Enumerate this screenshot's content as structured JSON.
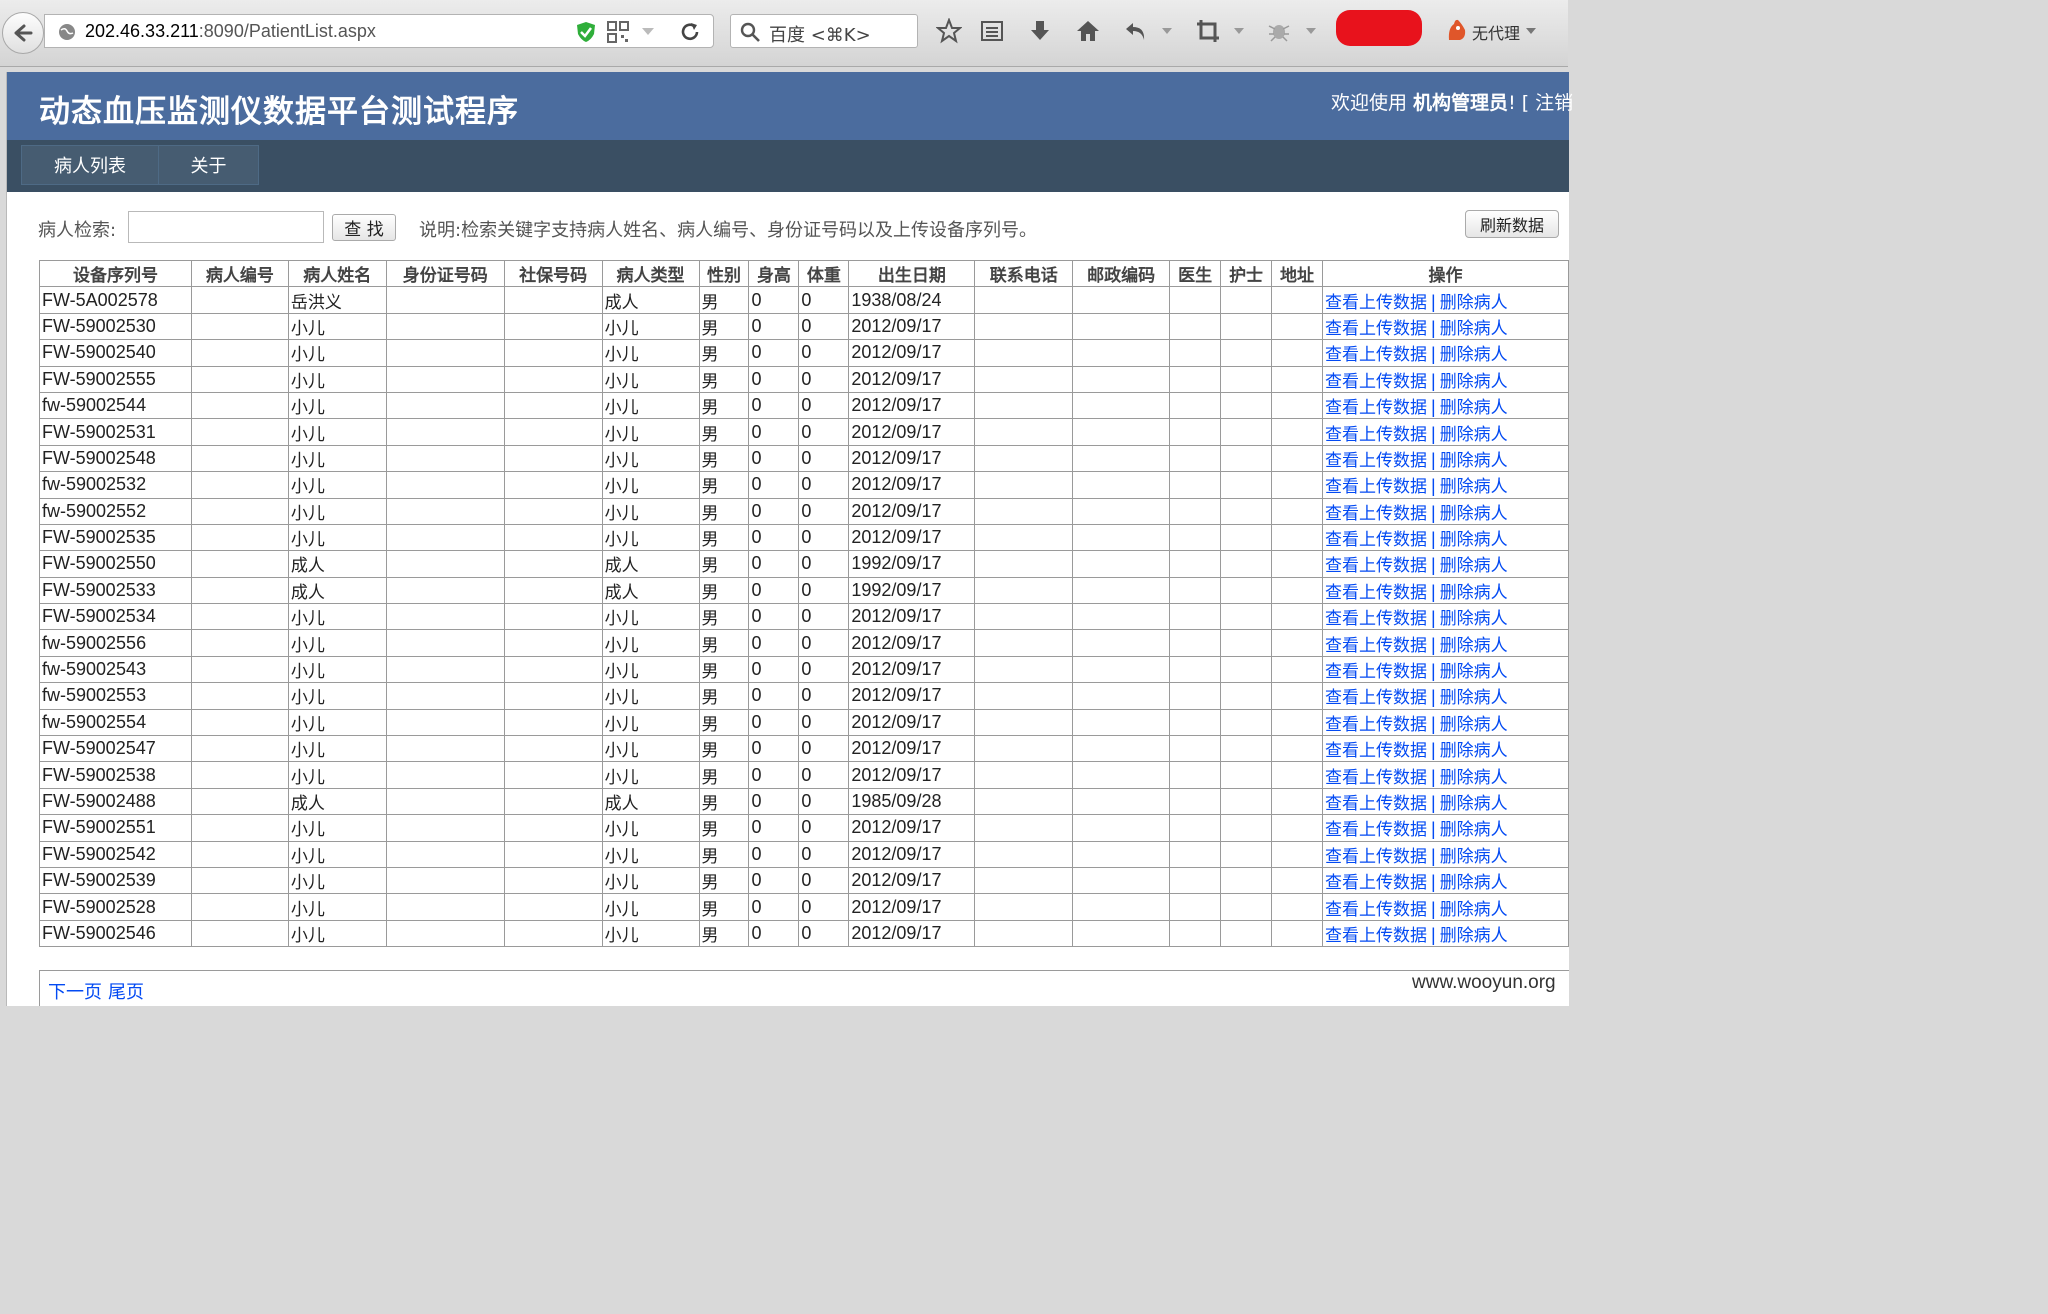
{
  "browser": {
    "url_host": "202.46.33.211",
    "url_rest": ":8090/PatientList.aspx",
    "search_placeholder": "百度 <⌘K>",
    "proxy_label": "无代理"
  },
  "header": {
    "site_title": "动态血压监测仪数据平台测试程序",
    "welcome_prefix": "欢迎使用 ",
    "user_name": "机构管理员",
    "welcome_suffix": "! [ 注销"
  },
  "nav": {
    "items": [
      "病人列表",
      "关于"
    ]
  },
  "search": {
    "label": "病人检索:",
    "value": "",
    "button": "查 找",
    "note": "说明:检索关键字支持病人姓名、病人编号、身份证号码以及上传设备序列号。",
    "refresh_button": "刷新数据"
  },
  "table": {
    "columns": [
      "设备序列号",
      "病人编号",
      "病人姓名",
      "身份证号码",
      "社保号码",
      "病人类型",
      "性别",
      "身高",
      "体重",
      "出生日期",
      "联系电话",
      "邮政编码",
      "医生",
      "护士",
      "地址",
      "操作"
    ],
    "action_view": "查看上传数据",
    "action_sep": "|",
    "action_delete": "删除病人",
    "rows": [
      {
        "serial": "FW-5A002578",
        "pid": "",
        "name": "岳洪义",
        "idcard": "",
        "insurance": "",
        "type": "成人",
        "sex": "男",
        "height": "0",
        "weight": "0",
        "dob": "1938/08/24",
        "phone": "",
        "zip": "",
        "doctor": "",
        "nurse": "",
        "address": ""
      },
      {
        "serial": "FW-59002530",
        "pid": "",
        "name": "小儿",
        "idcard": "",
        "insurance": "",
        "type": "小儿",
        "sex": "男",
        "height": "0",
        "weight": "0",
        "dob": "2012/09/17",
        "phone": "",
        "zip": "",
        "doctor": "",
        "nurse": "",
        "address": ""
      },
      {
        "serial": "FW-59002540",
        "pid": "",
        "name": "小儿",
        "idcard": "",
        "insurance": "",
        "type": "小儿",
        "sex": "男",
        "height": "0",
        "weight": "0",
        "dob": "2012/09/17",
        "phone": "",
        "zip": "",
        "doctor": "",
        "nurse": "",
        "address": ""
      },
      {
        "serial": "FW-59002555",
        "pid": "",
        "name": "小儿",
        "idcard": "",
        "insurance": "",
        "type": "小儿",
        "sex": "男",
        "height": "0",
        "weight": "0",
        "dob": "2012/09/17",
        "phone": "",
        "zip": "",
        "doctor": "",
        "nurse": "",
        "address": ""
      },
      {
        "serial": "fw-59002544",
        "pid": "",
        "name": "小儿",
        "idcard": "",
        "insurance": "",
        "type": "小儿",
        "sex": "男",
        "height": "0",
        "weight": "0",
        "dob": "2012/09/17",
        "phone": "",
        "zip": "",
        "doctor": "",
        "nurse": "",
        "address": ""
      },
      {
        "serial": "FW-59002531",
        "pid": "",
        "name": "小儿",
        "idcard": "",
        "insurance": "",
        "type": "小儿",
        "sex": "男",
        "height": "0",
        "weight": "0",
        "dob": "2012/09/17",
        "phone": "",
        "zip": "",
        "doctor": "",
        "nurse": "",
        "address": ""
      },
      {
        "serial": "FW-59002548",
        "pid": "",
        "name": "小儿",
        "idcard": "",
        "insurance": "",
        "type": "小儿",
        "sex": "男",
        "height": "0",
        "weight": "0",
        "dob": "2012/09/17",
        "phone": "",
        "zip": "",
        "doctor": "",
        "nurse": "",
        "address": ""
      },
      {
        "serial": "fw-59002532",
        "pid": "",
        "name": "小儿",
        "idcard": "",
        "insurance": "",
        "type": "小儿",
        "sex": "男",
        "height": "0",
        "weight": "0",
        "dob": "2012/09/17",
        "phone": "",
        "zip": "",
        "doctor": "",
        "nurse": "",
        "address": ""
      },
      {
        "serial": "fw-59002552",
        "pid": "",
        "name": "小儿",
        "idcard": "",
        "insurance": "",
        "type": "小儿",
        "sex": "男",
        "height": "0",
        "weight": "0",
        "dob": "2012/09/17",
        "phone": "",
        "zip": "",
        "doctor": "",
        "nurse": "",
        "address": ""
      },
      {
        "serial": "FW-59002535",
        "pid": "",
        "name": "小儿",
        "idcard": "",
        "insurance": "",
        "type": "小儿",
        "sex": "男",
        "height": "0",
        "weight": "0",
        "dob": "2012/09/17",
        "phone": "",
        "zip": "",
        "doctor": "",
        "nurse": "",
        "address": ""
      },
      {
        "serial": "FW-59002550",
        "pid": "",
        "name": "成人",
        "idcard": "",
        "insurance": "",
        "type": "成人",
        "sex": "男",
        "height": "0",
        "weight": "0",
        "dob": "1992/09/17",
        "phone": "",
        "zip": "",
        "doctor": "",
        "nurse": "",
        "address": ""
      },
      {
        "serial": "FW-59002533",
        "pid": "",
        "name": "成人",
        "idcard": "",
        "insurance": "",
        "type": "成人",
        "sex": "男",
        "height": "0",
        "weight": "0",
        "dob": "1992/09/17",
        "phone": "",
        "zip": "",
        "doctor": "",
        "nurse": "",
        "address": ""
      },
      {
        "serial": "FW-59002534",
        "pid": "",
        "name": "小儿",
        "idcard": "",
        "insurance": "",
        "type": "小儿",
        "sex": "男",
        "height": "0",
        "weight": "0",
        "dob": "2012/09/17",
        "phone": "",
        "zip": "",
        "doctor": "",
        "nurse": "",
        "address": ""
      },
      {
        "serial": "fw-59002556",
        "pid": "",
        "name": "小儿",
        "idcard": "",
        "insurance": "",
        "type": "小儿",
        "sex": "男",
        "height": "0",
        "weight": "0",
        "dob": "2012/09/17",
        "phone": "",
        "zip": "",
        "doctor": "",
        "nurse": "",
        "address": ""
      },
      {
        "serial": "fw-59002543",
        "pid": "",
        "name": "小儿",
        "idcard": "",
        "insurance": "",
        "type": "小儿",
        "sex": "男",
        "height": "0",
        "weight": "0",
        "dob": "2012/09/17",
        "phone": "",
        "zip": "",
        "doctor": "",
        "nurse": "",
        "address": ""
      },
      {
        "serial": "fw-59002553",
        "pid": "",
        "name": "小儿",
        "idcard": "",
        "insurance": "",
        "type": "小儿",
        "sex": "男",
        "height": "0",
        "weight": "0",
        "dob": "2012/09/17",
        "phone": "",
        "zip": "",
        "doctor": "",
        "nurse": "",
        "address": ""
      },
      {
        "serial": "fw-59002554",
        "pid": "",
        "name": "小儿",
        "idcard": "",
        "insurance": "",
        "type": "小儿",
        "sex": "男",
        "height": "0",
        "weight": "0",
        "dob": "2012/09/17",
        "phone": "",
        "zip": "",
        "doctor": "",
        "nurse": "",
        "address": ""
      },
      {
        "serial": "FW-59002547",
        "pid": "",
        "name": "小儿",
        "idcard": "",
        "insurance": "",
        "type": "小儿",
        "sex": "男",
        "height": "0",
        "weight": "0",
        "dob": "2012/09/17",
        "phone": "",
        "zip": "",
        "doctor": "",
        "nurse": "",
        "address": ""
      },
      {
        "serial": "FW-59002538",
        "pid": "",
        "name": "小儿",
        "idcard": "",
        "insurance": "",
        "type": "小儿",
        "sex": "男",
        "height": "0",
        "weight": "0",
        "dob": "2012/09/17",
        "phone": "",
        "zip": "",
        "doctor": "",
        "nurse": "",
        "address": ""
      },
      {
        "serial": "FW-59002488",
        "pid": "",
        "name": "成人",
        "idcard": "",
        "insurance": "",
        "type": "成人",
        "sex": "男",
        "height": "0",
        "weight": "0",
        "dob": "1985/09/28",
        "phone": "",
        "zip": "",
        "doctor": "",
        "nurse": "",
        "address": ""
      },
      {
        "serial": "FW-59002551",
        "pid": "",
        "name": "小儿",
        "idcard": "",
        "insurance": "",
        "type": "小儿",
        "sex": "男",
        "height": "0",
        "weight": "0",
        "dob": "2012/09/17",
        "phone": "",
        "zip": "",
        "doctor": "",
        "nurse": "",
        "address": ""
      },
      {
        "serial": "FW-59002542",
        "pid": "",
        "name": "小儿",
        "idcard": "",
        "insurance": "",
        "type": "小儿",
        "sex": "男",
        "height": "0",
        "weight": "0",
        "dob": "2012/09/17",
        "phone": "",
        "zip": "",
        "doctor": "",
        "nurse": "",
        "address": ""
      },
      {
        "serial": "FW-59002539",
        "pid": "",
        "name": "小儿",
        "idcard": "",
        "insurance": "",
        "type": "小儿",
        "sex": "男",
        "height": "0",
        "weight": "0",
        "dob": "2012/09/17",
        "phone": "",
        "zip": "",
        "doctor": "",
        "nurse": "",
        "address": ""
      },
      {
        "serial": "FW-59002528",
        "pid": "",
        "name": "小儿",
        "idcard": "",
        "insurance": "",
        "type": "小儿",
        "sex": "男",
        "height": "0",
        "weight": "0",
        "dob": "2012/09/17",
        "phone": "",
        "zip": "",
        "doctor": "",
        "nurse": "",
        "address": ""
      },
      {
        "serial": "FW-59002546",
        "pid": "",
        "name": "小儿",
        "idcard": "",
        "insurance": "",
        "type": "小儿",
        "sex": "男",
        "height": "0",
        "weight": "0",
        "dob": "2012/09/17",
        "phone": "",
        "zip": "",
        "doctor": "",
        "nurse": "",
        "address": ""
      }
    ]
  },
  "pager": {
    "next": "下一页",
    "last": "尾页"
  },
  "watermark": "www.wooyun.org",
  "colors": {
    "header_bg": "#4b6c9e",
    "nav_bg": "#3a4f63",
    "link": "#034af3"
  }
}
